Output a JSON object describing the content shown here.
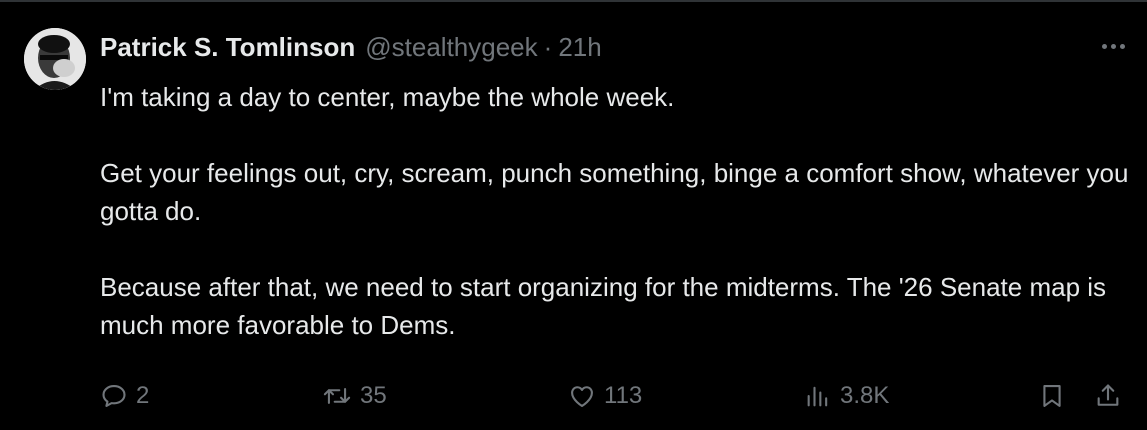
{
  "tweet": {
    "author_name": "Patrick S. Tomlinson",
    "author_handle": "@stealthygeek",
    "separator": "·",
    "time": "21h",
    "paragraphs": [
      "I'm taking a day to center, maybe the whole week.",
      "Get your feelings out, cry, scream, punch something, binge a comfort show, whatever you gotta do.",
      "Because after that, we need to start organizing for the midterms. The '26 Senate map is much more favorable to Dems."
    ]
  },
  "actions": {
    "replies": "2",
    "reposts": "35",
    "likes": "113",
    "views": "3.8K"
  },
  "icons": {
    "more": "more-icon",
    "reply": "reply-icon",
    "repost": "repost-icon",
    "like": "heart-icon",
    "views": "views-icon",
    "bookmark": "bookmark-icon",
    "share": "share-icon"
  },
  "colors": {
    "background": "#000000",
    "text": "#e7e9ea",
    "secondary": "#71767b",
    "divider": "#2f3336"
  }
}
